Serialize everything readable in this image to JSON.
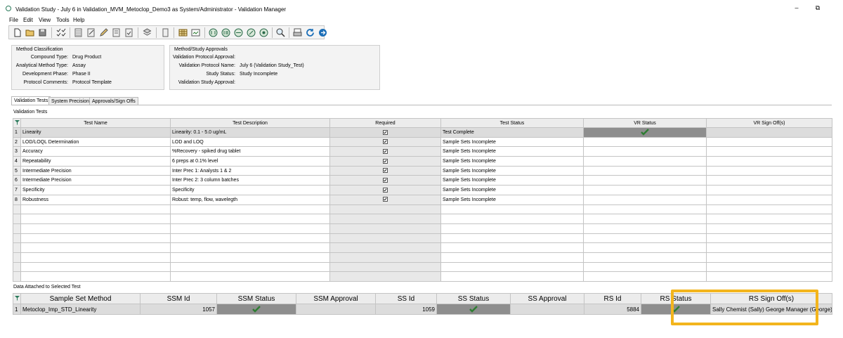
{
  "window": {
    "title": "Validation Study - July 6 in Validation_MVM_Metoclop_Demo3 as System/Administrator - Validation Manager",
    "minimize": "–",
    "restore": "⧉"
  },
  "menu": [
    "File",
    "Edit",
    "View",
    "Tools",
    "Help"
  ],
  "method_classification": {
    "title": "Method Classification",
    "fields": [
      {
        "label": "Compound Type:",
        "value": "Drug Product"
      },
      {
        "label": "Analytical Method Type:",
        "value": "Assay"
      },
      {
        "label": "Development Phase:",
        "value": "Phase II"
      },
      {
        "label": "Protocol Comments:",
        "value": "Protocol Template"
      }
    ]
  },
  "approvals": {
    "title": "Method/Study Approvals",
    "fields": [
      {
        "label": "Validation Protocol Approval:",
        "value": ""
      },
      {
        "label": "Validation Protocol Name:",
        "value": "July 6 (Validation Study_Test)"
      },
      {
        "label": "Study Status:",
        "value": "Study Incomplete"
      },
      {
        "label": "Validation Study Approval:",
        "value": ""
      }
    ]
  },
  "tabs": [
    "Validation Tests",
    "System Precision",
    "Approvals/Sign Offs"
  ],
  "validation_tests": {
    "section_label": "Validation Tests",
    "columns": [
      "Test Name",
      "Test Description",
      "Required",
      "Test Status",
      "VR Status",
      "VR Sign Off(s)"
    ],
    "rows": [
      {
        "n": "1",
        "name": "Linearity",
        "desc": "Linearity: 0.1 - 5.0 ug/mL",
        "required": true,
        "status": "Test Complete",
        "vr_ok": true,
        "signoff": ""
      },
      {
        "n": "2",
        "name": "LOD/LOQL Determination",
        "desc": "LOD and LOQ",
        "required": true,
        "status": "Sample Sets Incomplete",
        "vr_ok": false,
        "signoff": ""
      },
      {
        "n": "3",
        "name": "Accuracy",
        "desc": "%Recovery - spiked drug tablet",
        "required": true,
        "status": "Sample Sets Incomplete",
        "vr_ok": false,
        "signoff": ""
      },
      {
        "n": "4",
        "name": "Repeatability",
        "desc": "6 preps at 0.1% level",
        "required": true,
        "status": "Sample Sets Incomplete",
        "vr_ok": false,
        "signoff": ""
      },
      {
        "n": "5",
        "name": "Intermediate Precision",
        "desc": "Inter Prec 1: Analysts 1 & 2",
        "required": true,
        "status": "Sample Sets Incomplete",
        "vr_ok": false,
        "signoff": ""
      },
      {
        "n": "6",
        "name": "Intermediate Precision",
        "desc": "Inter Prec 2: 3 column batches",
        "required": true,
        "status": "Sample Sets Incomplete",
        "vr_ok": false,
        "signoff": ""
      },
      {
        "n": "7",
        "name": "Specificity",
        "desc": "Specificity",
        "required": true,
        "status": "Sample Sets Incomplete",
        "vr_ok": false,
        "signoff": ""
      },
      {
        "n": "8",
        "name": "Robustness",
        "desc": "Robust: temp, flow, wavelegth",
        "required": true,
        "status": "Sample Sets Incomplete",
        "vr_ok": false,
        "signoff": ""
      }
    ]
  },
  "data_attached": {
    "section_label": "Data Attached to Selected Test",
    "columns": [
      "Sample Set Method",
      "SSM Id",
      "SSM Status",
      "SSM Approval",
      "SS Id",
      "SS Status",
      "SS Approval",
      "RS Id",
      "RS Status",
      "RS Sign Off(s)"
    ],
    "rows": [
      {
        "n": "1",
        "method": "Metoclop_Imp_STD_Linearity",
        "ssm_id": "1057",
        "ssm_status_ok": true,
        "ssm_approval": "",
        "ss_id": "1059",
        "ss_status_ok": true,
        "ss_approval": "",
        "rs_id": "5884",
        "rs_status_ok": true,
        "rs_signoff": "Sally Chemist (Sally) George Manager (George)"
      }
    ]
  },
  "colors": {
    "highlight": "#f3b51d",
    "check": "#2e7d32",
    "selected_dark": "#8e8e8e"
  }
}
